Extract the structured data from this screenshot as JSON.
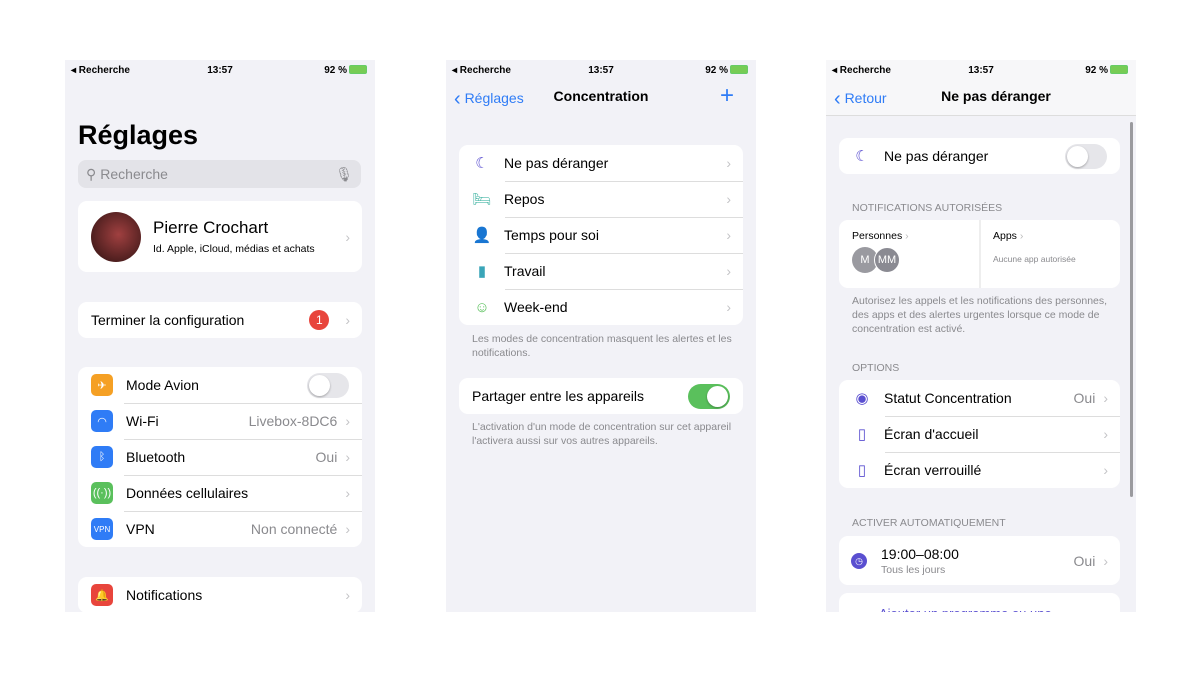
{
  "status": {
    "back": "◂ Recherche",
    "time": "13:57",
    "battery": "92 %"
  },
  "p1": {
    "title": "Réglages",
    "search_placeholder": "Recherche",
    "profile_name": "Pierre Crochart",
    "profile_sub": "Id. Apple, iCloud, médias et achats",
    "setup": "Terminer la configuration",
    "setup_badge": "1",
    "items": [
      {
        "label": "Mode Avion",
        "value": "",
        "color": "#f5a024",
        "icon": "airplane-icon",
        "glyph": "✈"
      },
      {
        "label": "Wi-Fi",
        "value": "Livebox-8DC6",
        "color": "#2f7cf6",
        "icon": "wifi-icon",
        "glyph": "◠"
      },
      {
        "label": "Bluetooth",
        "value": "Oui",
        "color": "#2f7cf6",
        "icon": "bluetooth-icon",
        "glyph": "ᛒ"
      },
      {
        "label": "Données cellulaires",
        "value": "",
        "color": "#5ac05c",
        "icon": "antenna-icon",
        "glyph": "((·))"
      },
      {
        "label": "VPN",
        "value": "Non connecté",
        "color": "#2f7cf6",
        "icon": "vpn-icon",
        "glyph": "VPN"
      }
    ],
    "notifications": "Notifications"
  },
  "p2": {
    "back": "Réglages",
    "title": "Concentration",
    "add": "+",
    "modes": [
      {
        "label": "Ne pas déranger",
        "glyph": "☾",
        "color": "#5a4fd0",
        "icon": "moon-icon"
      },
      {
        "label": "Repos",
        "glyph": "🛏",
        "color": "#4cb8a8",
        "icon": "bed-icon"
      },
      {
        "label": "Temps pour soi",
        "glyph": "👤",
        "color": "#9b4fd0",
        "icon": "person-icon"
      },
      {
        "label": "Travail",
        "glyph": "▮",
        "color": "#3aa5b8",
        "icon": "badge-icon"
      },
      {
        "label": "Week-end",
        "glyph": "☺",
        "color": "#5ac05c",
        "icon": "smiley-icon"
      }
    ],
    "modes_footer": "Les modes de concentration masquent les alertes et les notifications.",
    "share": "Partager entre les appareils",
    "share_on": true,
    "share_footer": "L'activation d'un mode de concentration sur cet appareil l'activera aussi sur vos autres appareils."
  },
  "p3": {
    "back": "Retour",
    "title": "Ne pas déranger",
    "toggle": "Ne pas déranger",
    "toggle_on": false,
    "notif_header": "NOTIFICATIONS AUTORISÉES",
    "people": "Personnes",
    "people_avatars": [
      "M",
      "MM"
    ],
    "apps": "Apps",
    "apps_none": "Aucune app autorisée",
    "notif_footer": "Autorisez les appels et les notifications des personnes, des apps et des alertes urgentes lorsque ce mode de concentration est activé.",
    "options_header": "OPTIONS",
    "options": [
      {
        "label": "Statut Concentration",
        "value": "Oui",
        "icon": "focus-status-icon",
        "glyph": "◉"
      },
      {
        "label": "Écran d'accueil",
        "value": "",
        "icon": "home-screen-icon",
        "glyph": "▯"
      },
      {
        "label": "Écran verrouillé",
        "value": "",
        "icon": "lock-screen-icon",
        "glyph": "▯"
      }
    ],
    "auto_header": "ACTIVER AUTOMATIQUEMENT",
    "schedule": "19:00–08:00",
    "schedule_sub": "Tous les jours",
    "schedule_value": "Oui",
    "add_schedule": "Ajouter un programme ou une automatisation"
  },
  "colors": {
    "accent": "#2f7cf6",
    "purple": "#5a4fd0",
    "badge": "#e8453c",
    "toggle_on": "#5ac05c"
  }
}
